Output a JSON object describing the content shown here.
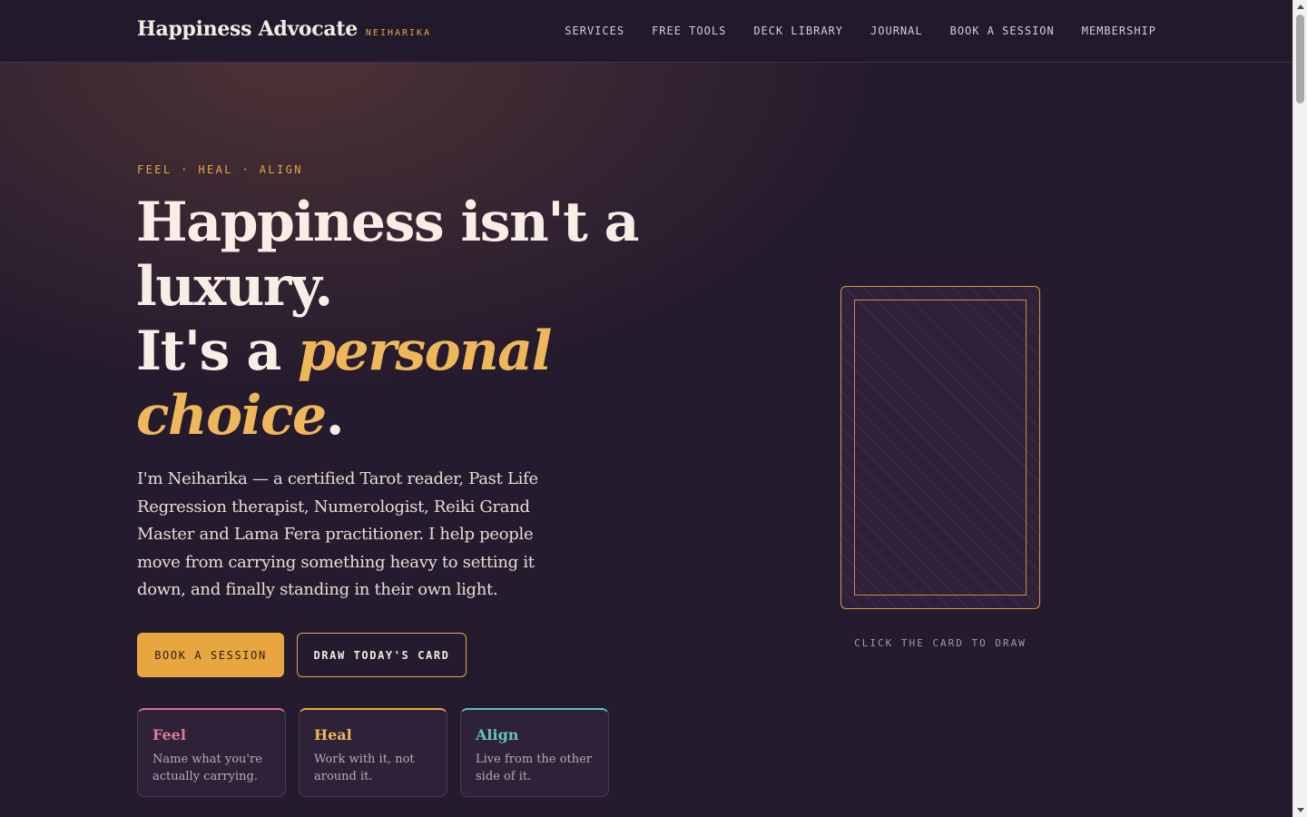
{
  "header": {
    "brand_name": "Happiness Advocate",
    "brand_sub": "NEIHARIKA",
    "nav": [
      "SERVICES",
      "FREE TOOLS",
      "DECK LIBRARY",
      "JOURNAL",
      "BOOK A SESSION",
      "MEMBERSHIP"
    ]
  },
  "hero": {
    "eyebrow": "FEEL · HEAL · ALIGN",
    "headline_line1": "Happiness isn't a luxury.",
    "headline_line2_prefix": "It's a ",
    "headline_accent": "personal choice",
    "headline_suffix": ".",
    "intro": "I'm Neiharika — a certified Tarot reader, Past Life Regression therapist, Numerologist, Reiki Grand Master and Lama Fera practitioner. I help people move from carrying something heavy to setting it down, and finally standing in their own light.",
    "primary_button": "BOOK A SESSION",
    "secondary_button": "DRAW TODAY'S CARD"
  },
  "pillars": [
    {
      "title": "Feel",
      "text": "Name what you're actually carrying."
    },
    {
      "title": "Heal",
      "text": "Work with it, not around it."
    },
    {
      "title": "Align",
      "text": "Live from the other side of it."
    }
  ],
  "card": {
    "hint": "CLICK THE CARD TO DRAW"
  },
  "colors": {
    "background": "#251b2e",
    "accent": "#e8a73e",
    "feel": "#e07b97",
    "heal": "#f0b75a",
    "align": "#62c7b8"
  }
}
